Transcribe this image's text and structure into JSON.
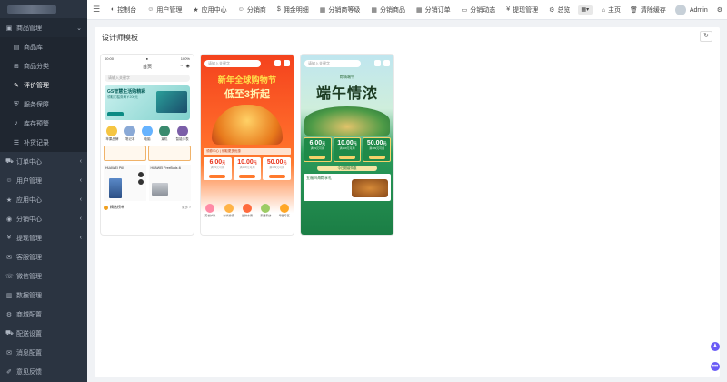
{
  "sidebar": {
    "items": [
      {
        "label": "商品管理",
        "icon": "cube-icon",
        "expanded": true
      },
      {
        "label": "商品库",
        "icon": "bag-icon",
        "sub": true
      },
      {
        "label": "商品分类",
        "icon": "sitemap-icon",
        "sub": true
      },
      {
        "label": "评价管理",
        "icon": "edit-icon",
        "sub": true
      },
      {
        "label": "服务保障",
        "icon": "shield-icon",
        "sub": true
      },
      {
        "label": "库存预警",
        "icon": "bell-icon",
        "sub": true
      },
      {
        "label": "补货记录",
        "icon": "list-icon",
        "sub": true
      },
      {
        "label": "订单中心",
        "icon": "cart-icon"
      },
      {
        "label": "用户管理",
        "icon": "user-icon"
      },
      {
        "label": "应用中心",
        "icon": "star-icon"
      },
      {
        "label": "分销中心",
        "icon": "user-circle-icon"
      },
      {
        "label": "提现管理",
        "icon": "yen-icon"
      },
      {
        "label": "客服管理",
        "icon": "chat-icon"
      },
      {
        "label": "微信管理",
        "icon": "wechat-icon"
      },
      {
        "label": "数据管理",
        "icon": "chart-icon"
      },
      {
        "label": "商城配置",
        "icon": "settings-icon"
      },
      {
        "label": "配送设置",
        "icon": "truck-icon"
      },
      {
        "label": "消息配置",
        "icon": "message-icon"
      },
      {
        "label": "意见反馈",
        "icon": "feedback-icon"
      }
    ]
  },
  "topbar": {
    "nav": [
      {
        "label": "控制台",
        "icon": "dashboard-icon"
      },
      {
        "label": "用户管理",
        "icon": "user-icon"
      },
      {
        "label": "应用中心",
        "icon": "star-icon"
      },
      {
        "label": "分销商",
        "icon": "user-icon"
      },
      {
        "label": "佣金明细",
        "icon": "dollar-icon"
      },
      {
        "label": "分销商等级",
        "icon": "table-icon"
      },
      {
        "label": "分销商品",
        "icon": "table-icon"
      },
      {
        "label": "分销订单",
        "icon": "table-icon"
      },
      {
        "label": "分销动态",
        "icon": "id-card-icon"
      },
      {
        "label": "提现管理",
        "icon": "yen-icon"
      },
      {
        "label": "总览",
        "icon": "gear-icon"
      }
    ],
    "home_label": "主页",
    "clear_cache_label": "清除缓存",
    "admin_label": "Admin"
  },
  "panel": {
    "title": "设计师模板"
  },
  "templates": [
    {
      "name": "template-1",
      "status_time": "00:00",
      "status_right": "100%",
      "header": "首页",
      "search_placeholder": "请输入关键字",
      "banner_title": "GS智慧生活购精彩",
      "banner_sub": "领取门槛券满￥200元",
      "cats": [
        "苹果品牌",
        "笔记本",
        "电脑",
        "耳机",
        "智能手表"
      ],
      "prod1_title": "HUAWEI P60",
      "prod2_title": "HUAWEI FreeBuds 4i",
      "section_title": "精选榜单",
      "section_more": "更多 >"
    },
    {
      "name": "template-2",
      "search_placeholder": "请输入关键字",
      "headline1": "新年全球购物节",
      "headline2": "低至3折起",
      "strip": "领券中心 | 领取更多优惠",
      "prices": [
        {
          "value": "6.00",
          "unit": "元",
          "desc": "满99元可用"
        },
        {
          "value": "10.00",
          "unit": "元",
          "desc": "满199元可用"
        },
        {
          "value": "50.00",
          "unit": "元",
          "desc": "满499元可用"
        }
      ],
      "cats": [
        "美妆护肤",
        "时尚穿搭",
        "生鲜水果",
        "家居家纺",
        "母婴专区"
      ]
    },
    {
      "name": "template-3",
      "search_placeholder": "请输入关键字",
      "small": "粽情端午",
      "title": "端午情浓",
      "prices": [
        {
          "value": "6.00",
          "unit": "元",
          "desc": "满99元可用"
        },
        {
          "value": "10.00",
          "unit": "元",
          "desc": "满199元可用"
        },
        {
          "value": "50.00",
          "unit": "元",
          "desc": "满499元可用"
        }
      ],
      "ribbon": "今日超级特惠",
      "card_title": "五福四海粽享礼"
    }
  ]
}
